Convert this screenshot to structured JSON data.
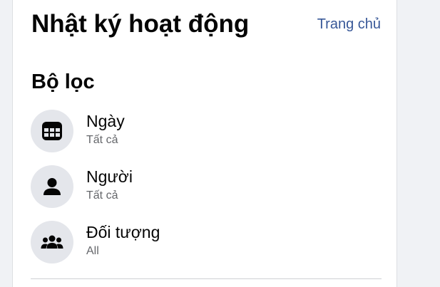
{
  "header": {
    "title": "Nhật ký hoạt động",
    "home_link": "Trang chủ"
  },
  "filters": {
    "title": "Bộ lọc",
    "items": [
      {
        "label": "Ngày",
        "value": "Tất cả",
        "icon": "calendar-icon"
      },
      {
        "label": "Người",
        "value": "Tất cả",
        "icon": "person-icon"
      },
      {
        "label": "Đối tượng",
        "value": "All",
        "icon": "group-icon"
      }
    ]
  },
  "colors": {
    "background": "#f0f2f5",
    "panel": "#ffffff",
    "link": "#385898",
    "icon_bg": "#e4e6eb",
    "text_primary": "#050505",
    "text_secondary": "#65676b"
  }
}
